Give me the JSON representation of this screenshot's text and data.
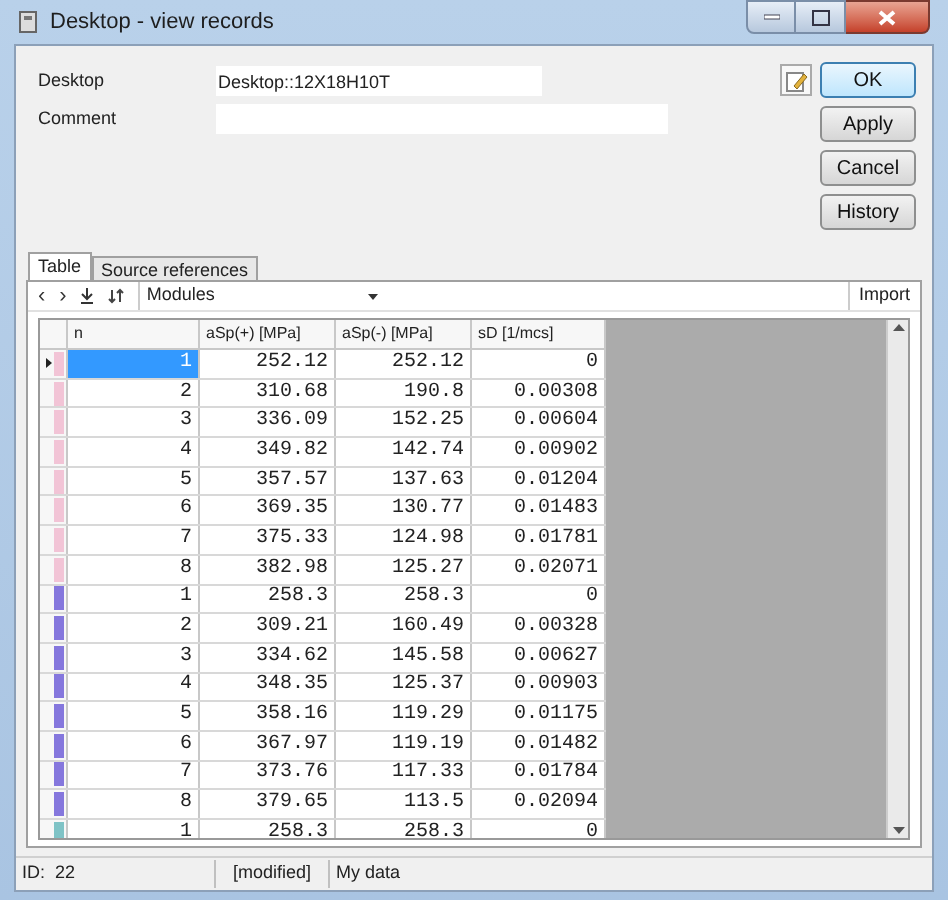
{
  "window": {
    "title": "Desktop - view records"
  },
  "fields": [
    {
      "label": "Desktop",
      "value": "Desktop::12X18H10T"
    },
    {
      "label": "Comment"
    }
  ],
  "buttons": [
    "OK",
    "Apply",
    "Cancel",
    "History"
  ],
  "tabs": [
    {
      "label": "Table",
      "selected": true
    },
    {
      "label": "Source references",
      "selected": false
    }
  ],
  "toolbar": {
    "prev": "‹",
    "next": "›",
    "dropdown": "Modules",
    "import": "Import"
  },
  "table": {
    "columns": [
      "n",
      "aSp(+) [MPa]",
      "aSp(-) [MPa]",
      "sD [1/mcs]"
    ],
    "rows": [
      {
        "color": "#f2c4d6",
        "selected": true,
        "cells": [
          "1",
          "252.12",
          "252.12",
          "0"
        ]
      },
      {
        "color": "#f2c4d6",
        "selected": false,
        "cells": [
          "2",
          "310.68",
          "190.8",
          "0.00308"
        ]
      },
      {
        "color": "#f2c4d6",
        "selected": false,
        "cells": [
          "3",
          "336.09",
          "152.25",
          "0.00604"
        ]
      },
      {
        "color": "#f2c4d6",
        "selected": false,
        "cells": [
          "4",
          "349.82",
          "142.74",
          "0.00902"
        ]
      },
      {
        "color": "#f2c4d6",
        "selected": false,
        "cells": [
          "5",
          "357.57",
          "137.63",
          "0.01204"
        ]
      },
      {
        "color": "#f2c4d6",
        "selected": false,
        "cells": [
          "6",
          "369.35",
          "130.77",
          "0.01483"
        ]
      },
      {
        "color": "#f2c4d6",
        "selected": false,
        "cells": [
          "7",
          "375.33",
          "124.98",
          "0.01781"
        ]
      },
      {
        "color": "#f2c4d6",
        "selected": false,
        "cells": [
          "8",
          "382.98",
          "125.27",
          "0.02071"
        ]
      },
      {
        "color": "#8577dd",
        "selected": false,
        "cells": [
          "1",
          "258.3",
          "258.3",
          "0"
        ]
      },
      {
        "color": "#8577dd",
        "selected": false,
        "cells": [
          "2",
          "309.21",
          "160.49",
          "0.00328"
        ]
      },
      {
        "color": "#8577dd",
        "selected": false,
        "cells": [
          "3",
          "334.62",
          "145.58",
          "0.00627"
        ]
      },
      {
        "color": "#8577dd",
        "selected": false,
        "cells": [
          "4",
          "348.35",
          "125.37",
          "0.00903"
        ]
      },
      {
        "color": "#8577dd",
        "selected": false,
        "cells": [
          "5",
          "358.16",
          "119.29",
          "0.01175"
        ]
      },
      {
        "color": "#8577dd",
        "selected": false,
        "cells": [
          "6",
          "367.97",
          "119.19",
          "0.01482"
        ]
      },
      {
        "color": "#8577dd",
        "selected": false,
        "cells": [
          "7",
          "373.76",
          "117.33",
          "0.01784"
        ]
      },
      {
        "color": "#8577dd",
        "selected": false,
        "cells": [
          "8",
          "379.65",
          "113.5",
          "0.02094"
        ]
      },
      {
        "color": "#7fc3c6",
        "selected": false,
        "cells": [
          "1",
          "258.3",
          "258.3",
          "0"
        ]
      }
    ]
  },
  "status_bar": [
    "ID:  22",
    "[modified]",
    "My data"
  ]
}
